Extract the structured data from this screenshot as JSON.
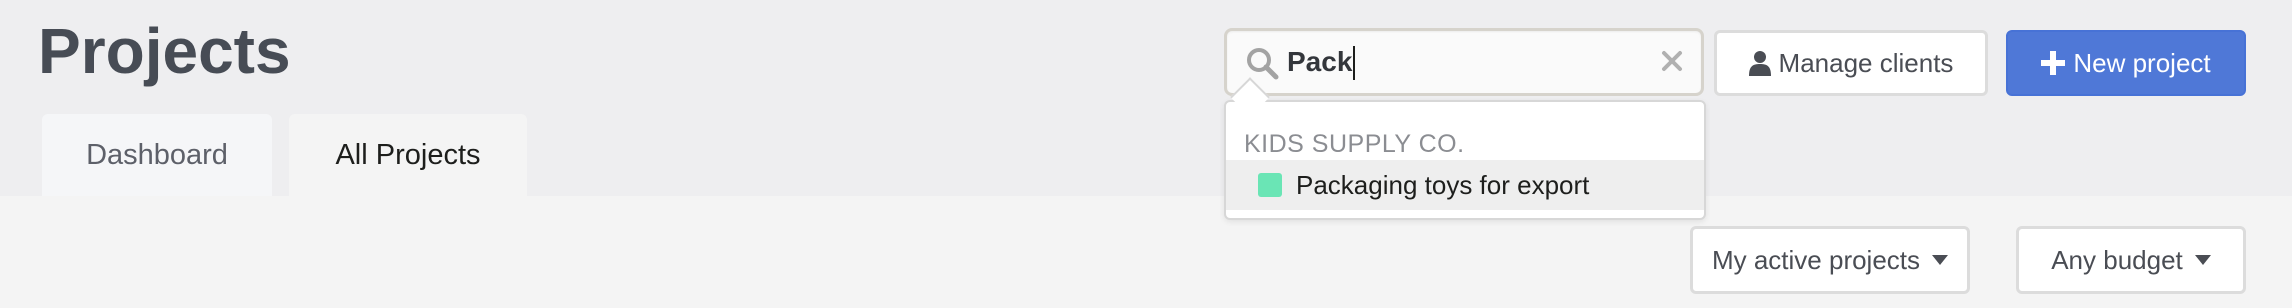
{
  "header": {
    "title": "Projects",
    "tabs": [
      {
        "label": "Dashboard",
        "active": false
      },
      {
        "label": "All Projects",
        "active": true
      }
    ]
  },
  "search": {
    "value": "Pack",
    "icon": "search-icon",
    "clear_icon": "close-icon"
  },
  "results": {
    "group_label": "KIDS SUPPLY CO.",
    "items": [
      {
        "label": "Packaging toys for export",
        "color": "#6ae5b5"
      }
    ]
  },
  "buttons": {
    "manage_clients": "Manage clients",
    "new_project": "New project"
  },
  "filters": {
    "active": "My active projects",
    "budget": "Any budget"
  },
  "colors": {
    "primary": "#4f78d7",
    "title": "#474c55"
  }
}
